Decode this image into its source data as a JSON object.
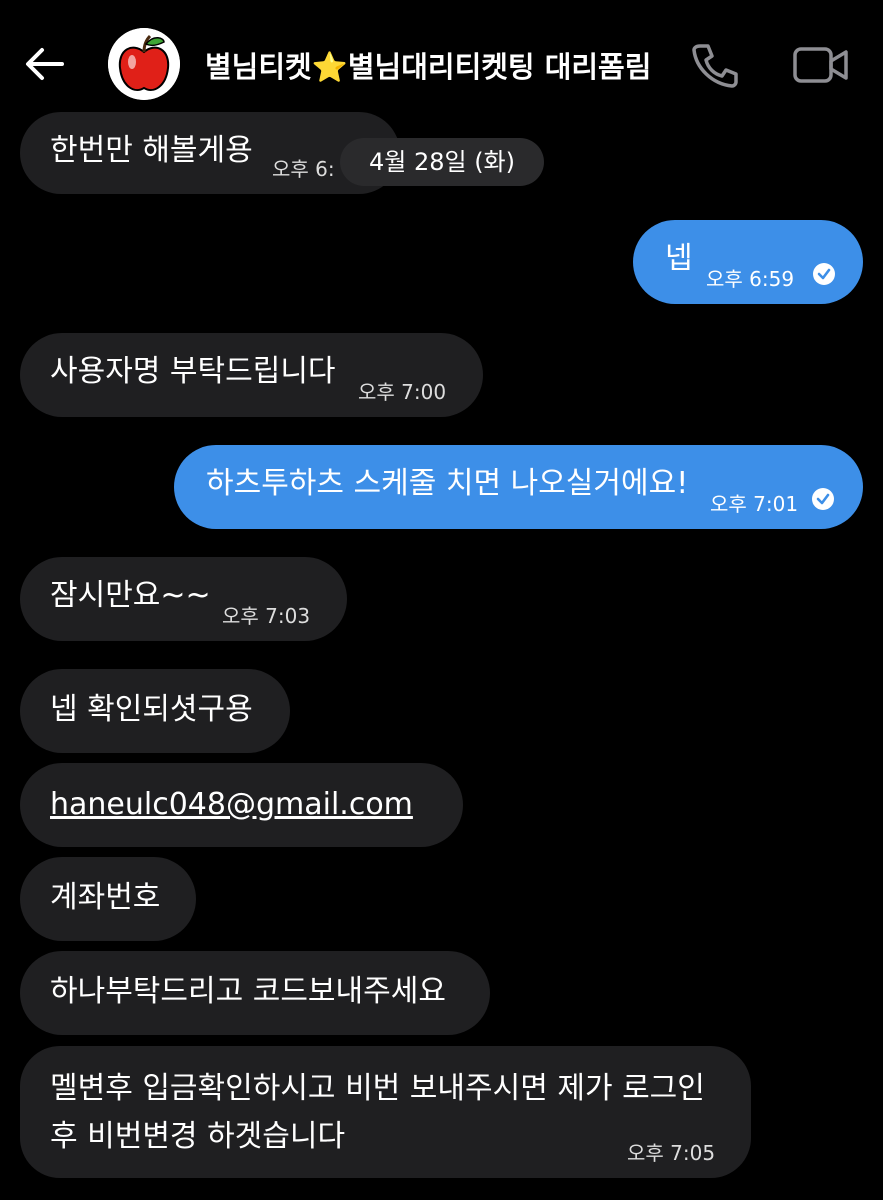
{
  "header": {
    "title_left": "별님티켓",
    "title_star": "⭐",
    "title_right": "별님대리티켓팅 대리폼림"
  },
  "date_divider": "4월 28일 (화)",
  "messages": [
    {
      "text": "한번만 해볼게용",
      "time": "오후 6:"
    },
    {
      "text": "넵",
      "time": "오후 6:59"
    },
    {
      "text": "사용자명 부탁드립니다",
      "time": "오후 7:00"
    },
    {
      "text": "하츠투하츠 스케줄 치면 나오실거에요!",
      "time": "오후 7:01"
    },
    {
      "text": "잠시만요~~",
      "time": "오후 7:03"
    },
    {
      "text": "넵 확인되셧구용"
    },
    {
      "text": "haneulc048@gmail.com"
    },
    {
      "text": "계좌번호"
    },
    {
      "text": "하나부탁드리고 코드보내주세요"
    },
    {
      "line1": "멜변후 입금확인하시고 비번 보내주시면 제가 로그인",
      "line2": "후 비번변경 하겟습니다",
      "time": "오후 7:05"
    }
  ]
}
